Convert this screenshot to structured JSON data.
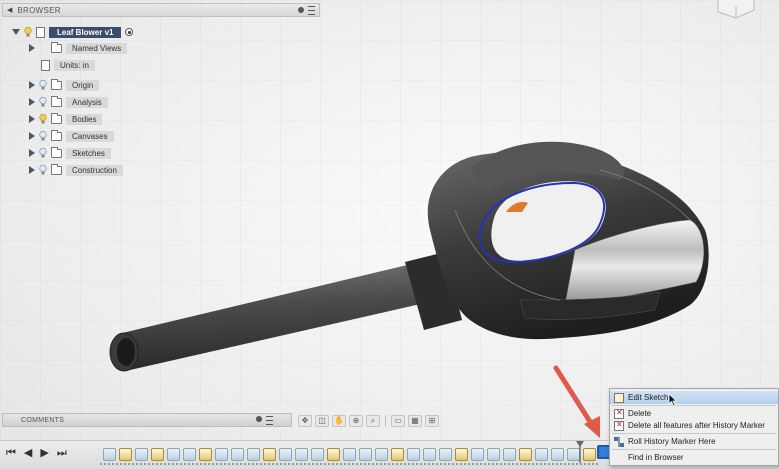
{
  "browser": {
    "title": "BROWSER",
    "root": {
      "label": "Leaf Blower v1"
    },
    "items": [
      {
        "label": "Named Views"
      },
      {
        "label": "Units: in"
      },
      {
        "label": "Origin"
      },
      {
        "label": "Analysis"
      },
      {
        "label": "Bodies"
      },
      {
        "label": "Canvases"
      },
      {
        "label": "Sketches"
      },
      {
        "label": "Construction"
      }
    ]
  },
  "comments": {
    "label": "COMMENTS"
  },
  "context_menu": {
    "items": [
      {
        "label": "Edit Sketch",
        "icon": "edit-sketch-icon",
        "highlighted": true
      },
      {
        "label": "Delete",
        "icon": "delete-icon"
      },
      {
        "label": "Delete all features after History Marker",
        "icon": "delete-icon"
      },
      {
        "label": "Roll History Marker Here",
        "icon": "roll-history-icon"
      },
      {
        "label": "Find in Browser",
        "icon": ""
      }
    ]
  },
  "colors": {
    "root_label_bg": "#3b4c6e",
    "menu_highlight": "#b5d0ef",
    "arrow": "#e05a4a",
    "sketch_profile": "#2233bb",
    "selected_feature": "#2f7ed8"
  }
}
